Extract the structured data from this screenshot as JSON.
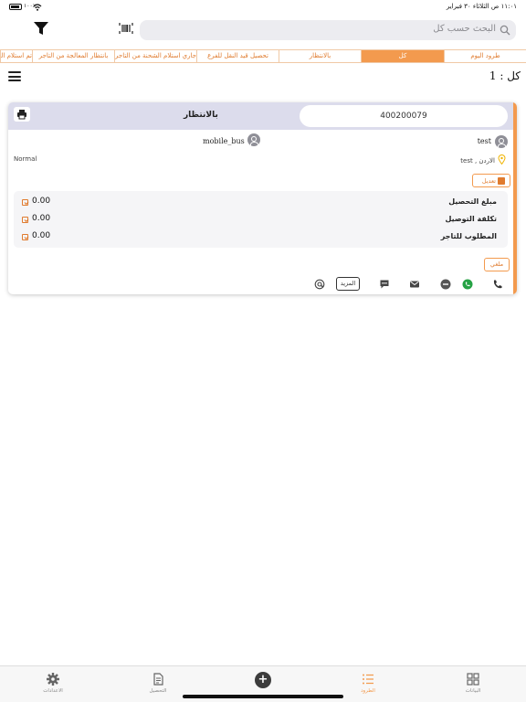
{
  "status_bar": {
    "time": "١١:٠١ ص   الثلاثاء ٣٠ فبراير",
    "battery": "١٠٠٪"
  },
  "search": {
    "placeholder": "البحث حسب كل"
  },
  "tabs": [
    {
      "label": "طرود اليوم",
      "active": false
    },
    {
      "label": "كل",
      "active": true
    },
    {
      "label": "بالانتظار",
      "active": false
    },
    {
      "label": "تحصيل قيد النقل للفرع",
      "active": false
    },
    {
      "label": "جاري استلام الشحنة من التاجر",
      "active": false
    },
    {
      "label": "بانتظار المعالجة من التاجر",
      "active": false
    },
    {
      "label": "تم استلام الطرد",
      "active": false
    }
  ],
  "list": {
    "count_label": "كل : 1"
  },
  "card": {
    "tracking_number": "400200079",
    "status": "بالانتظار",
    "customer_name": "test",
    "driver_name": "mobile_bus",
    "priority": "Normal",
    "address": "الاردن , test",
    "edit_label": "تعديل",
    "financials": [
      {
        "label": "مبلغ التحصيل",
        "value": "0.00"
      },
      {
        "label": "تكلفة التوصيل",
        "value": "0.00"
      },
      {
        "label": "المطلوب للتاجر",
        "value": "0.00"
      }
    ],
    "cancel_label": "ملغي",
    "more_label": "المزيد"
  },
  "bottom_nav": {
    "statistics": "البيانات",
    "parcels": "الطرود",
    "collection": "التحصيل",
    "settings": "الاعدادات"
  },
  "colors": {
    "accent": "#f39a4e",
    "header_bg": "#dcdcec",
    "whatsapp": "#25a244"
  }
}
